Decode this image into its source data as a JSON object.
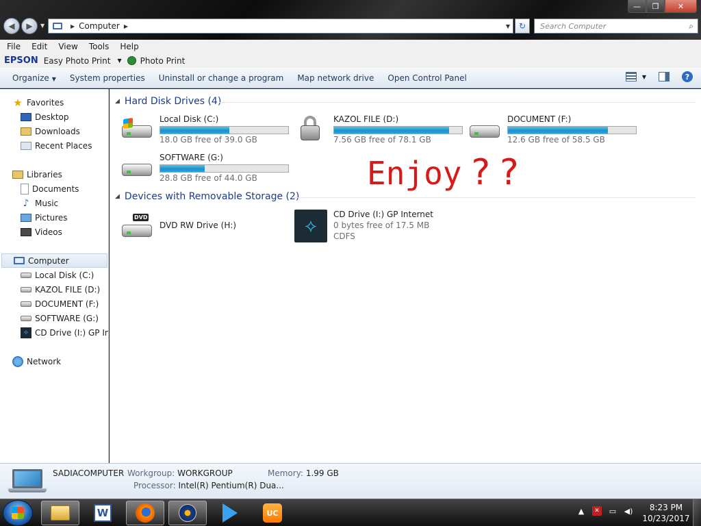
{
  "window": {
    "address": "Computer",
    "search_placeholder": "Search Computer",
    "controls": {
      "minimize": "—",
      "maximize": "❐",
      "close": "✕"
    }
  },
  "menubar": [
    "File",
    "Edit",
    "View",
    "Tools",
    "Help"
  ],
  "epson": {
    "logo": "EPSON",
    "app": "Easy Photo Print",
    "print": "Photo Print"
  },
  "command_bar": {
    "organize": "Organize",
    "system_properties": "System properties",
    "uninstall": "Uninstall or change a program",
    "map_drive": "Map network drive",
    "control_panel": "Open Control Panel"
  },
  "sidebar": {
    "favorites": "Favorites",
    "desktop": "Desktop",
    "downloads": "Downloads",
    "recent_places": "Recent Places",
    "libraries": "Libraries",
    "documents": "Documents",
    "music": "Music",
    "pictures": "Pictures",
    "videos": "Videos",
    "computer": "Computer",
    "local_disk": "Local Disk (C:)",
    "kazol": "KAZOL FILE (D:)",
    "document": "DOCUMENT (F:)",
    "software": "SOFTWARE (G:)",
    "cd_drive": "CD Drive (I:) GP Internet",
    "network": "Network"
  },
  "groups": {
    "hard_disks": {
      "title": "Hard Disk Drives (4)"
    },
    "removable": {
      "title": "Devices with Removable Storage (2)"
    }
  },
  "drives": {
    "c": {
      "name": "Local Disk (C:)",
      "free": "18.0 GB free of 39.0 GB",
      "used_fraction": 0.54
    },
    "d": {
      "name": "KAZOL FILE (D:)",
      "free": "7.56 GB free of 78.1 GB",
      "used_fraction": 0.9
    },
    "f": {
      "name": "DOCUMENT (F:)",
      "free": "12.6 GB free of 58.5 GB",
      "used_fraction": 0.78
    },
    "g": {
      "name": "SOFTWARE (G:)",
      "free": "28.8 GB free of 44.0 GB",
      "used_fraction": 0.35
    },
    "h": {
      "name": "DVD RW Drive (H:)",
      "label": "DVD"
    },
    "i": {
      "name": "CD Drive (I:) GP Internet",
      "free": "0 bytes free of 17.5 MB",
      "fs": "CDFS"
    }
  },
  "overlay": {
    "word": "Enjoy",
    "marks": "??"
  },
  "details": {
    "computer_name": "SADIACOMPUTER",
    "workgroup_label": "Workgroup:",
    "workgroup": "WORKGROUP",
    "memory_label": "Memory:",
    "memory": "1.99 GB",
    "processor_label": "Processor:",
    "processor": "Intel(R) Pentium(R) Dua..."
  },
  "taskbar": {
    "word_letter": "W",
    "uc_letter": "UC",
    "time": "8:23 PM",
    "date": "10/23/2017"
  },
  "colors": {
    "accent": "#1e3a8a",
    "overlay_text": "#d61a1a",
    "bar_fill": "#1e8ec8"
  }
}
